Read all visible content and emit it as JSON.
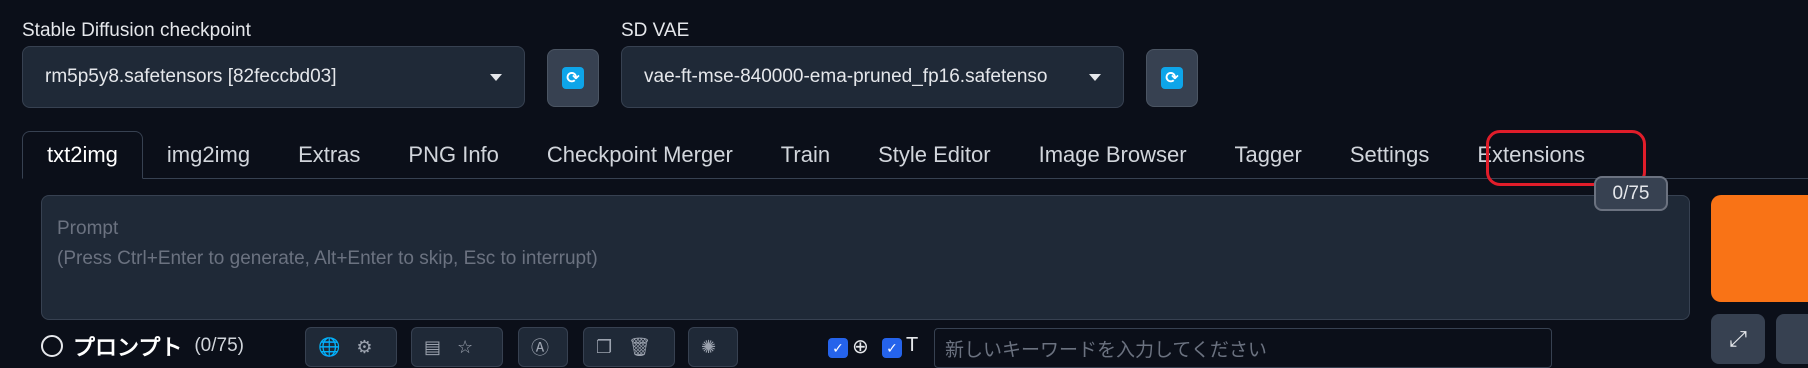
{
  "checkpoint": {
    "label": "Stable Diffusion checkpoint",
    "value": "rm5p5y8.safetensors [82feccbd03]"
  },
  "vae": {
    "label": "SD VAE",
    "value": "vae-ft-mse-840000-ema-pruned_fp16.safetenso"
  },
  "tabs": [
    {
      "label": "txt2img",
      "active": true
    },
    {
      "label": "img2img"
    },
    {
      "label": "Extras"
    },
    {
      "label": "PNG Info"
    },
    {
      "label": "Checkpoint Merger"
    },
    {
      "label": "Train"
    },
    {
      "label": "Style Editor"
    },
    {
      "label": "Image Browser"
    },
    {
      "label": "Tagger"
    },
    {
      "label": "Settings"
    },
    {
      "label": "Extensions",
      "highlighted": true
    }
  ],
  "prompt": {
    "placeholder_line1": "Prompt",
    "placeholder_line2": "(Press Ctrl+Enter to generate, Alt+Enter to skip, Esc to interrupt)",
    "token_counter": "0/75"
  },
  "prompt_helper": {
    "title": "プロンプト",
    "count": "(0/75)",
    "keyword_placeholder": "新しいキーワードを入力してください"
  },
  "icons": [
    "refresh-icon",
    "globe-icon",
    "gear-icon",
    "clipboard-icon",
    "star-icon",
    "translate-icon",
    "copy-icon",
    "trash-icon",
    "openai-icon",
    "resize-icon"
  ],
  "colors": {
    "background": "#0b0f19",
    "accent": "#f97316",
    "highlight": "#e11d2a",
    "refresh": "#0ea5e9"
  }
}
